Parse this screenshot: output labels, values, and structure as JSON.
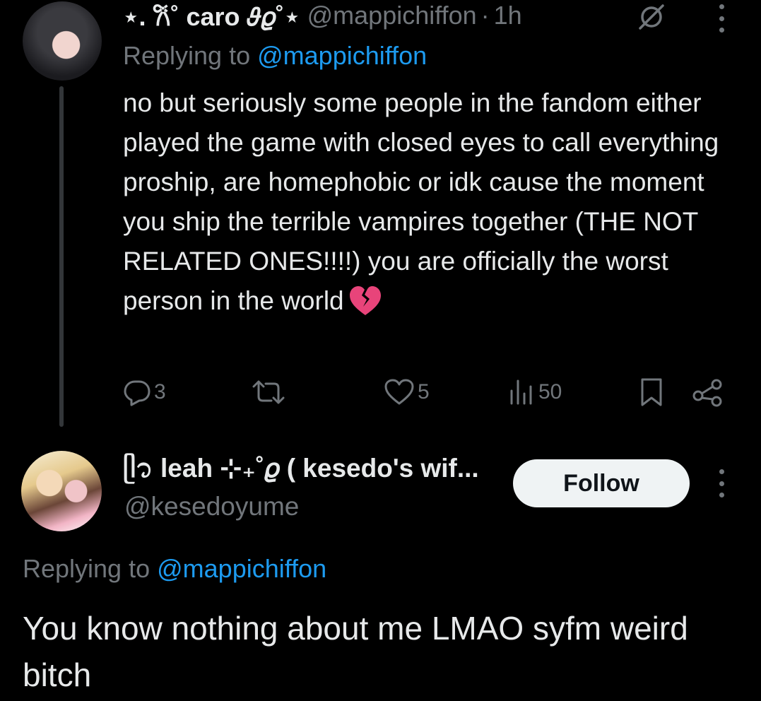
{
  "tweet1": {
    "display_name": "⋆. 𐙚˚ caro 𝜗𝜚˚⋆",
    "handle": "@mappichiffon",
    "separator": "·",
    "time": "1h",
    "replying_prefix": "Replying to",
    "replying_to": "@mappichiffon",
    "text": "no but seriously some people in the fandom either played the game with closed eyes to call everything proship, are homephobic or idk cause the moment you ship the terrible vampires together (THE NOT RELATED ONES!!!!) you are officially the worst person in the world",
    "emoji": "broken-heart",
    "replies": "3",
    "likes": "5",
    "views": "50"
  },
  "tweet2": {
    "display_name": "ᥫ᭡ leah ⊹₊˚𝜚 ( kesedo's wif...",
    "handle": "@kesedoyume",
    "follow_label": "Follow",
    "replying_prefix": "Replying to",
    "replying_to": "@mappichiffon",
    "text": "You know nothing about me LMAO syfm weird bitch"
  },
  "colors": {
    "background": "#000000",
    "text": "#e7e9ea",
    "muted": "#71767b",
    "accent": "#1d9bf0",
    "follow_bg": "#eff3f4",
    "heart_emoji": "#e8447a"
  }
}
